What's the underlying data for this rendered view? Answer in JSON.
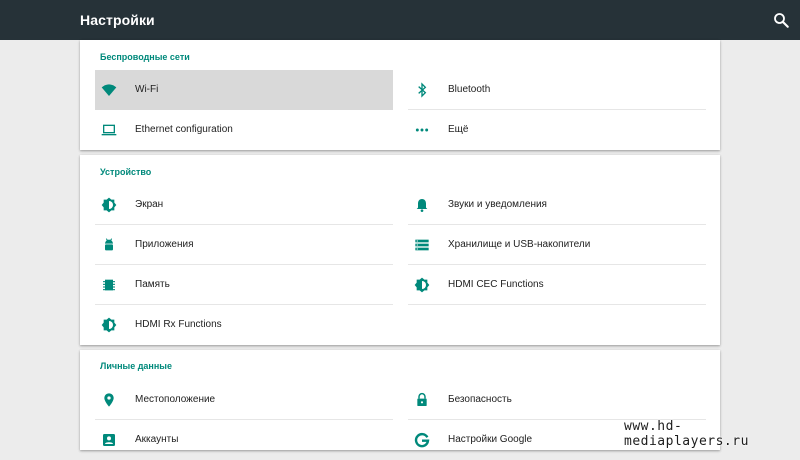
{
  "appbar": {
    "title": "Настройки",
    "search_icon": "search-icon"
  },
  "accent_color": "#00897b",
  "appbar_color": "#263238",
  "sections": {
    "wireless": {
      "title": "Беспроводные сети",
      "items": {
        "wifi": {
          "label": "Wi-Fi",
          "icon": "wifi-icon",
          "selected": true
        },
        "bluetooth": {
          "label": "Bluetooth",
          "icon": "bluetooth-icon"
        },
        "ethernet": {
          "label": "Ethernet configuration",
          "icon": "laptop-icon"
        },
        "more": {
          "label": "Ещё",
          "icon": "more-dots-icon"
        }
      }
    },
    "device": {
      "title": "Устройство",
      "items": {
        "display": {
          "label": "Экран",
          "icon": "brightness-icon"
        },
        "sound": {
          "label": "Звуки и уведомления",
          "icon": "bell-icon"
        },
        "apps": {
          "label": "Приложения",
          "icon": "android-icon"
        },
        "storage": {
          "label": "Хранилище и USB-накопители",
          "icon": "storage-icon"
        },
        "memory": {
          "label": "Память",
          "icon": "memory-icon"
        },
        "hdmi_cec": {
          "label": "HDMI CEC Functions",
          "icon": "brightness-icon"
        },
        "hdmi_rx": {
          "label": "HDMI Rx Functions",
          "icon": "brightness-icon"
        }
      }
    },
    "personal": {
      "title": "Личные данные",
      "items": {
        "location": {
          "label": "Местоположение",
          "icon": "location-pin-icon"
        },
        "security": {
          "label": "Безопасность",
          "icon": "lock-icon"
        },
        "accounts": {
          "label": "Аккаунты",
          "icon": "account-box-icon"
        },
        "google": {
          "label": "Настройки Google",
          "icon": "google-icon"
        }
      }
    }
  },
  "watermark": "www.hd-mediaplayers.ru"
}
